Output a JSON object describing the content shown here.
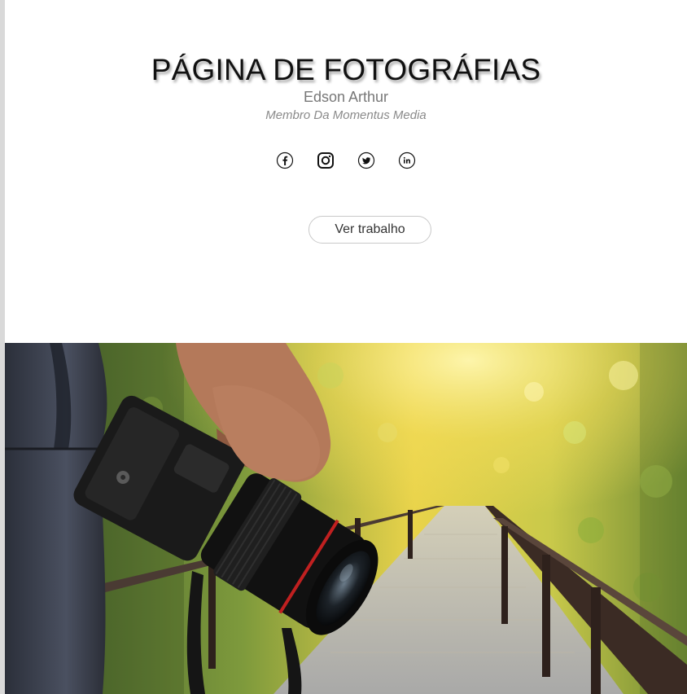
{
  "header": {
    "title": "PÁGINA DE FOTOGRÁFIAS",
    "author": "Edson Arthur",
    "role": "Membro Da Momentus Media"
  },
  "social": {
    "icons": [
      "facebook-icon",
      "instagram-icon",
      "twitter-icon",
      "linkedin-icon"
    ]
  },
  "cta": {
    "label": "Ver trabalho"
  },
  "hero": {
    "subject": "hero-photo"
  },
  "colors": {
    "title": "#111111",
    "author": "#777777",
    "role": "#8a8a8a",
    "button_border": "#c9c9c9"
  }
}
